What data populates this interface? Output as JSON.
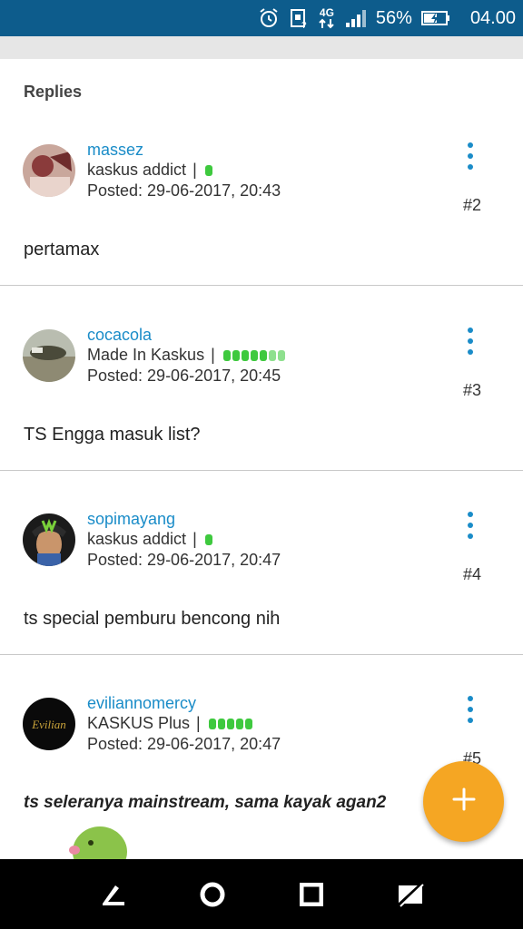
{
  "status_bar": {
    "network": "4G",
    "battery": "56%",
    "time": "04.00",
    "icons": [
      "alarm-icon",
      "sim-icon",
      "network-4g-icon",
      "signal-icon",
      "battery-charging-icon"
    ]
  },
  "section": {
    "title": "Replies"
  },
  "posts": [
    {
      "username": "massez",
      "rank": "kaskus addict",
      "separator": "|",
      "rep_level": 1,
      "posted": "Posted: 29-06-2017, 20:43",
      "number": "#2",
      "body": "pertamax"
    },
    {
      "username": "cocacola",
      "rank": "Made In Kaskus",
      "separator": "|",
      "rep_level": 7,
      "posted": "Posted: 29-06-2017, 20:45",
      "number": "#3",
      "body": "TS Engga masuk list?"
    },
    {
      "username": "sopimayang",
      "rank": "kaskus addict",
      "separator": "|",
      "rep_level": 1,
      "posted": "Posted: 29-06-2017, 20:47",
      "number": "#4",
      "body": "ts special pemburu bencong nih"
    },
    {
      "username": "eviliannomercy",
      "rank": "KASKUS Plus",
      "separator": "|",
      "rep_level": 5,
      "posted": "Posted: 29-06-2017, 20:47",
      "number": "#5",
      "body": "ts seleranya mainstream, sama kayak agan2"
    }
  ],
  "fab": {
    "icon": "plus-icon",
    "color": "#f5a623"
  },
  "nav_bar": {
    "icons": [
      "back-icon",
      "home-icon",
      "recents-icon",
      "screenshot-off-icon"
    ]
  },
  "colors": {
    "status_bar": "#0d5c8c",
    "username": "#1a8cc8",
    "rep_dot": "#3ec93e"
  }
}
